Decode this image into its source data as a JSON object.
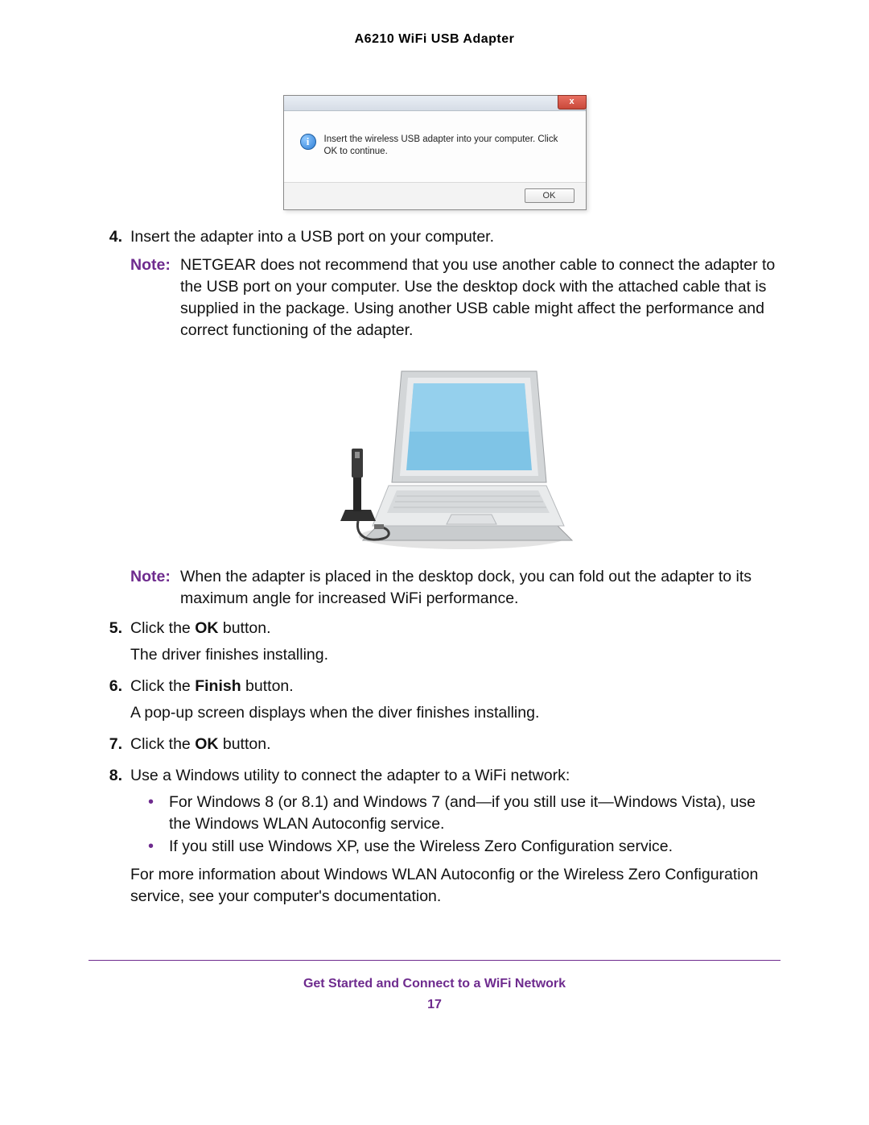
{
  "header": {
    "product_title": "A6210 WiFi USB Adapter"
  },
  "dialog": {
    "titlebar_blur": "",
    "close_glyph": "x",
    "info_glyph": "i",
    "message": "Insert the wireless USB adapter into your computer. Click OK to continue.",
    "ok_label": "OK"
  },
  "steps": {
    "s4_num": "4.",
    "s4_text": "Insert the adapter into a USB port on your computer.",
    "note1_label": "Note:",
    "note1_text": "NETGEAR does not recommend that you use another cable to connect the adapter to the USB port on your computer. Use the desktop dock with the attached cable that is supplied in the package. Using another USB cable might affect the performance and correct functioning of the adapter.",
    "note2_label": "Note:",
    "note2_text": "When the adapter is placed in the desktop dock, you can fold out the adapter to its maximum angle for increased WiFi performance.",
    "s5_num": "5.",
    "s5_pre": "Click the ",
    "s5_bold": "OK",
    "s5_post": " button.",
    "s5_body2": "The driver finishes installing.",
    "s6_num": "6.",
    "s6_pre": "Click the ",
    "s6_bold": "Finish",
    "s6_post": " button.",
    "s6_body2": "A pop-up screen displays when the diver finishes installing.",
    "s7_num": "7.",
    "s7_pre": "Click the ",
    "s7_bold": "OK",
    "s7_post": " button.",
    "s8_num": "8.",
    "s8_text": "Use a Windows utility to connect the adapter to a WiFi network:",
    "b1": "For Windows 8 (or 8.1) and Windows 7 (and—if you still use it—Windows Vista), use the Windows WLAN Autoconfig service.",
    "b2": "If you still use Windows XP, use the Wireless Zero Configuration service.",
    "s8_tail": "For more information about Windows WLAN Autoconfig or the Wireless Zero Configuration service, see your computer's documentation.",
    "bullet_glyph": "•"
  },
  "footer": {
    "section_title": "Get Started and Connect to a WiFi Network",
    "page_number": "17"
  }
}
